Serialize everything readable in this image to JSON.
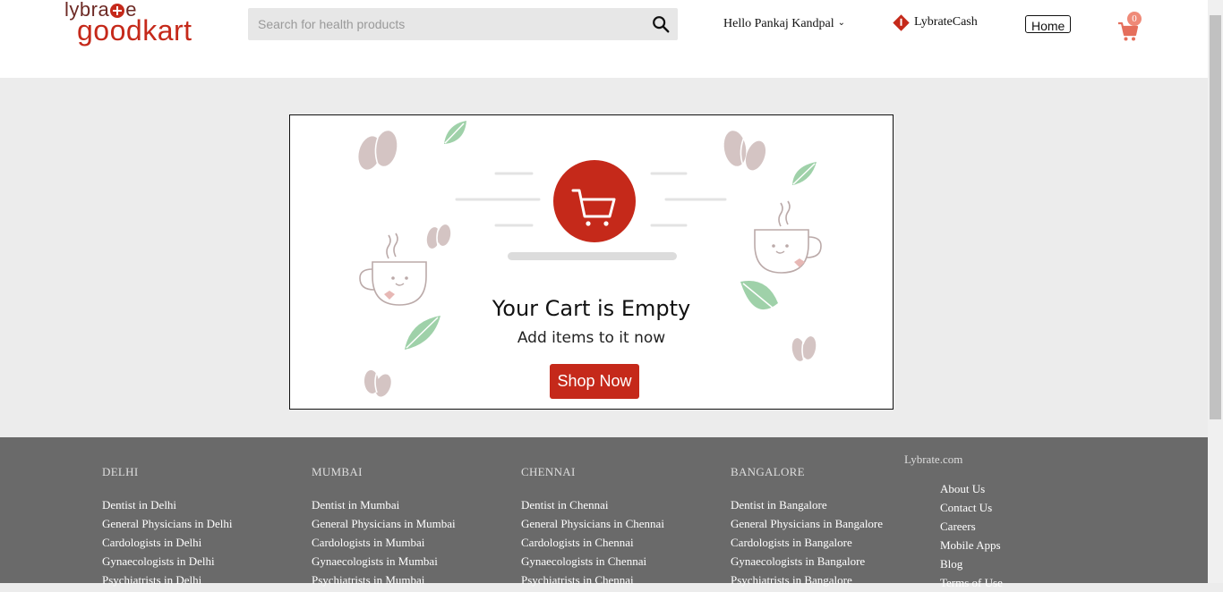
{
  "brand": {
    "logo_top": "lybra",
    "logo_top_end": "e",
    "logo_bottom": "goodkart"
  },
  "search": {
    "placeholder": "Search for health products"
  },
  "header": {
    "greeting": "Hello Pankaj Kandpal",
    "lybrate_cash": "LybrateCash",
    "home_label": "Home",
    "cart_count": "0"
  },
  "empty_cart": {
    "title": "Your Cart is Empty",
    "subtitle": "Add items to it now",
    "shop_label": "Shop Now"
  },
  "colors": {
    "brand_red": "#c5291a",
    "footer_bg": "#6a6a6a",
    "leaf_green": "#9fd1a9",
    "bean": "#d4c4c3"
  },
  "footer": {
    "columns": [
      {
        "heading": "DELHI",
        "links": [
          "Dentist in Delhi",
          "General Physicians in Delhi",
          "Cardologists in Delhi",
          "Gynaecologists in Delhi",
          "Psychiatrists in Delhi"
        ]
      },
      {
        "heading": "MUMBAI",
        "links": [
          "Dentist in Mumbai",
          "General Physicians in Mumbai",
          "Cardologists in Mumbai",
          "Gynaecologists in Mumbai",
          "Psychiatrists in Mumbai"
        ]
      },
      {
        "heading": "CHENNAI",
        "links": [
          "Dentist in Chennai",
          "General Physicians in Chennai",
          "Cardologists in Chennai",
          "Gynaecologists in Chennai",
          "Psychiatrists in Chennai"
        ]
      },
      {
        "heading": "BANGALORE",
        "links": [
          "Dentist in Bangalore",
          "General Physicians in Bangalore",
          "Cardologists in Bangalore",
          "Gynaecologists in Bangalore",
          "Psychiatrists in Bangalore"
        ]
      }
    ],
    "lybrate": {
      "heading": "Lybrate.com",
      "links": [
        "About Us",
        "Contact Us",
        "Careers",
        "Mobile Apps",
        "Blog",
        "Terms of Use"
      ]
    }
  }
}
